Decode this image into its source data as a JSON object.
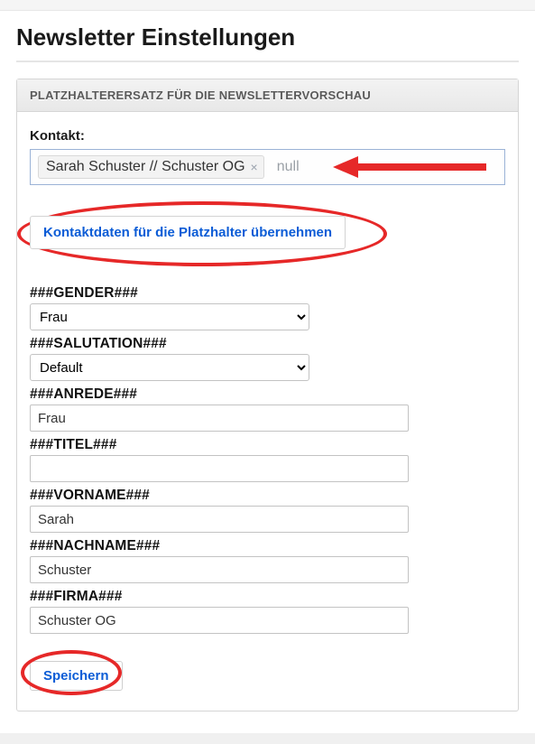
{
  "page_title": "Newsletter Einstellungen",
  "panel_header": "PLATZHALTERERSATZ FÜR DIE NEWSLETTERVORSCHAU",
  "contact": {
    "label": "Kontakt:",
    "tag_text": "Sarah Schuster // Schuster OG",
    "null_text": "null"
  },
  "apply_button": "Kontaktdaten für die Platzhalter übernehmen",
  "fields": {
    "gender": {
      "label": "###GENDER###",
      "value": "Frau",
      "type": "select"
    },
    "salutation": {
      "label": "###SALUTATION###",
      "value": "Default",
      "type": "select"
    },
    "anrede": {
      "label": "###ANREDE###",
      "value": "Frau",
      "type": "text"
    },
    "titel": {
      "label": "###TITEL###",
      "value": "",
      "type": "text"
    },
    "vorname": {
      "label": "###VORNAME###",
      "value": "Sarah",
      "type": "text"
    },
    "nachname": {
      "label": "###NACHNAME###",
      "value": "Schuster",
      "type": "text"
    },
    "firma": {
      "label": "###FIRMA###",
      "value": "Schuster OG",
      "type": "text"
    }
  },
  "save_button": "Speichern",
  "annotation_colors": {
    "highlight": "#e62828"
  }
}
